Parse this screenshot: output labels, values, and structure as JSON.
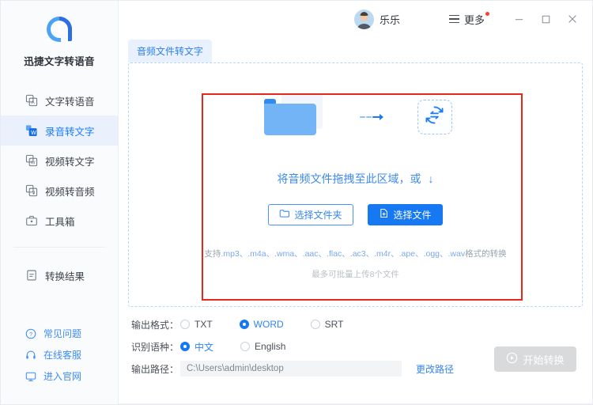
{
  "sidebar": {
    "brand": {
      "name": "迅捷文字转语音",
      "logo_icon": "app-logo-icon",
      "logo_color": "#2b8cf0"
    },
    "items": [
      {
        "label": "文字转语音",
        "icon": "text-to-speech-icon",
        "active": false
      },
      {
        "label": "录音转文字",
        "icon": "audio-to-text-icon",
        "active": true
      },
      {
        "label": "视频转文字",
        "icon": "video-to-text-icon",
        "active": false
      },
      {
        "label": "视频转音频",
        "icon": "video-to-audio-icon",
        "active": false
      },
      {
        "label": "工具箱",
        "icon": "toolbox-icon",
        "active": false
      }
    ],
    "results": {
      "label": "转换结果",
      "icon": "results-clipboard-icon"
    },
    "links": [
      {
        "label": "常见问题",
        "icon": "question-circle-icon"
      },
      {
        "label": "在线客服",
        "icon": "headset-icon"
      },
      {
        "label": "进入官网",
        "icon": "monitor-icon"
      }
    ]
  },
  "titlebar": {
    "user_name": "乐乐",
    "avatar_icon": "avatar",
    "more_label": "更多",
    "more_icon": "hamburger-icon",
    "more_badge": "•",
    "minimize_icon": "minimize-icon",
    "maximize_icon": "maximize-icon",
    "close_icon": "close-icon"
  },
  "tabs": [
    {
      "label": "音频文件转文字",
      "active": true
    }
  ],
  "dropzone": {
    "folder_icon": "folder-icon",
    "arrow_icon": "arrow-right-icon",
    "convert_icon": "convert-sync-icon",
    "title": "将音频文件拖拽至此区域，或",
    "title_arrow": "↓",
    "choose_folder_label": "选择文件夹",
    "choose_folder_icon": "folder-open-icon",
    "choose_file_label": "选择文件",
    "choose_file_icon": "file-add-icon",
    "formats_prefix": "支持",
    "formats_list": ".mp3、.m4a、.wma、.aac、.flac、.ac3、.m4r、.ape、.ogg、.wav",
    "formats_suffix": "格式的转换",
    "limit_text": "最多可批量上传8个文件",
    "highlight_color": "#e8261b"
  },
  "options": {
    "format": {
      "label": "输出格式：",
      "choices": [
        {
          "label": "TXT",
          "selected": false
        },
        {
          "label": "WORD",
          "selected": true
        },
        {
          "label": "SRT",
          "selected": false
        }
      ]
    },
    "language": {
      "label": "识别语种：",
      "choices": [
        {
          "label": "中文",
          "selected": true
        },
        {
          "label": "English",
          "selected": false
        }
      ]
    },
    "path": {
      "label": "输出路径：",
      "value": "C:\\Users\\admin\\desktop",
      "placeholder": "C:\\Users\\admin\\desktop",
      "change_label": "更改路径"
    },
    "start": {
      "label": "开始转换",
      "icon": "play-circle-icon",
      "disabled": true,
      "color": "#d9dadc"
    }
  },
  "colors": {
    "accent": "#1678f2",
    "accent_light": "#eaf1fd",
    "text": "#4a4f58",
    "muted": "#9aa3af",
    "danger": "#e8261b"
  }
}
